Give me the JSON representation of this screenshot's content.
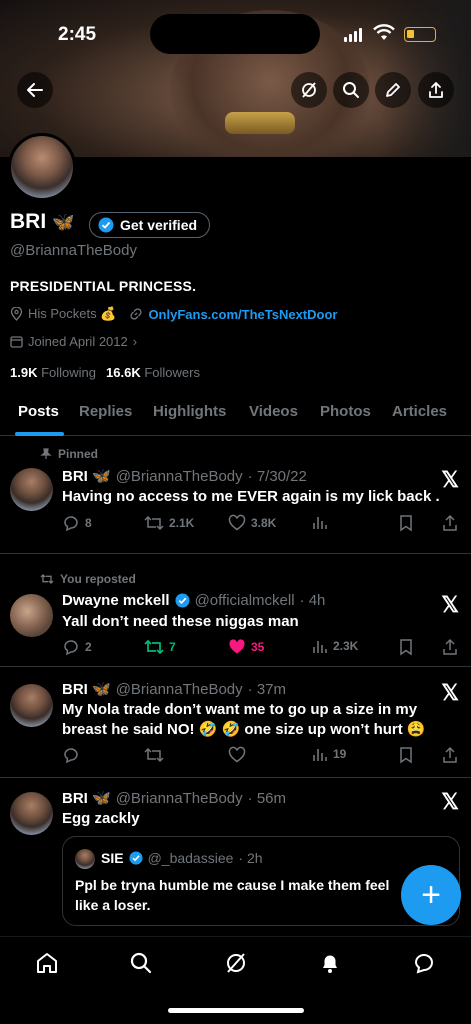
{
  "status_bar": {
    "time": "2:45"
  },
  "profile": {
    "name": "BRI",
    "name_emoji": "🦋",
    "get_verified_label": "Get verified",
    "handle": "@BriannaTheBody",
    "bio": "PRESIDENTIAL PRINCESS.",
    "location": "His Pockets 💰",
    "link": "OnlyFans.com/TheTsNextDoor",
    "joined": "Joined April 2012",
    "following_count": "1.9K",
    "following_label": "Following",
    "followers_count": "16.6K",
    "followers_label": "Followers"
  },
  "tabs": [
    "Posts",
    "Replies",
    "Highlights",
    "Videos",
    "Photos",
    "Articles"
  ],
  "posts": [
    {
      "context": "Pinned",
      "display_name": "BRI 🦋",
      "username": "@BriannaTheBody",
      "time": "· 7/30/22",
      "text": "Having no access to me EVER again is my lick back .",
      "replies": "8",
      "reposts": "2.1K",
      "likes": "3.8K",
      "views": ""
    },
    {
      "context": "You reposted",
      "display_name": "Dwayne mckell",
      "username": "@officialmckell",
      "time": "· 4h",
      "text": "Yall don’t need these niggas man",
      "replies": "2",
      "reposts": "7",
      "likes": "35",
      "views": "2.3K"
    },
    {
      "display_name": "BRI 🦋",
      "username": "@BriannaTheBody",
      "time": "· 37m",
      "text": "My Nola trade don’t want me to go up a size in my breast he said NO! 🤣 🤣 one size up won’t hurt 😩",
      "replies": "",
      "reposts": "",
      "likes": "",
      "views": "19"
    },
    {
      "display_name": "BRI 🦋",
      "username": "@BriannaTheBody",
      "time": "· 56m",
      "text": "Egg zackly",
      "quote": {
        "display_name": "SIE",
        "username": "@_badassiee",
        "time": "· 2h",
        "text": "Ppl be tryna humble me cause I make them feel like a loser."
      }
    }
  ],
  "colors": {
    "accent": "#1d9bf0",
    "repost_green": "#00ba7c",
    "like_pink": "#f91880",
    "muted": "#71767b"
  },
  "icons": [
    "back-arrow-icon",
    "grok-icon",
    "search-icon",
    "pencil-icon",
    "share-icon",
    "x-logo-icon",
    "home-icon",
    "bell-icon",
    "messages-icon"
  ]
}
